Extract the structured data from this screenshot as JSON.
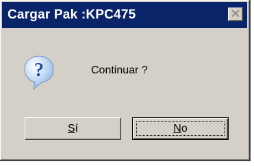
{
  "window": {
    "title": "Cargar Pak :KPC475",
    "close_icon": "close-icon"
  },
  "dialog": {
    "icon": "question-icon",
    "message": "Continuar ?"
  },
  "buttons": {
    "yes": {
      "mnemonic": "S",
      "rest": "í"
    },
    "no": {
      "mnemonic": "N",
      "rest": "o"
    }
  },
  "colors": {
    "titlebar": "#0a246a",
    "face": "#d4d0c8",
    "icon_blue": "#2d7fd6"
  }
}
